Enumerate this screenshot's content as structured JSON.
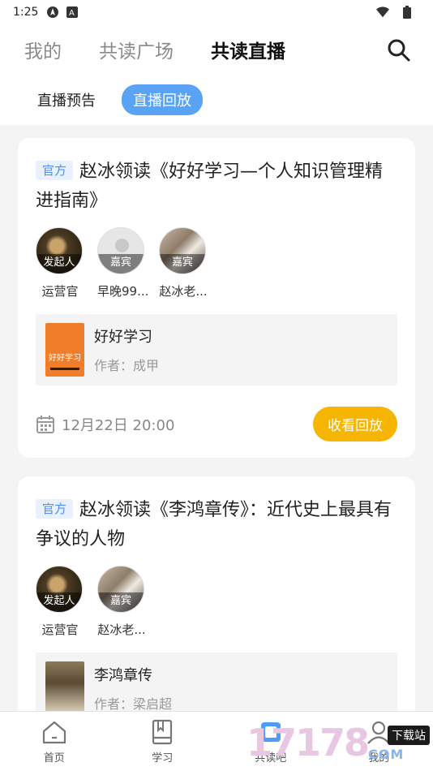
{
  "status_bar": {
    "time": "1:25",
    "icons": [
      "navigation-icon",
      "text-a-icon",
      "wifi-icon",
      "battery-icon"
    ]
  },
  "top_tabs": {
    "items": [
      {
        "label": "我的",
        "active": false
      },
      {
        "label": "共读广场",
        "active": false
      },
      {
        "label": "共读直播",
        "active": true
      }
    ],
    "search_icon": "search-icon"
  },
  "sub_tabs": {
    "items": [
      {
        "label": "直播预告",
        "active": false
      },
      {
        "label": "直播回放",
        "active": true
      }
    ]
  },
  "cards": [
    {
      "tag": "官方",
      "title": "赵冰领读《好好学习—个人知识管理精进指南》",
      "members": [
        {
          "role": "发起人",
          "name": "运营官"
        },
        {
          "role": "嘉宾",
          "name": "早晚99..."
        },
        {
          "role": "嘉宾",
          "name": "赵冰老..."
        }
      ],
      "book": {
        "title": "好好学习",
        "author": "作者：成甲",
        "cover_text": "好好学习"
      },
      "date": "12月22日 20:00",
      "button": "收看回放"
    },
    {
      "tag": "官方",
      "title": "赵冰领读《李鸿章传》：近代史上最具有争议的人物",
      "members": [
        {
          "role": "发起人",
          "name": "运营官"
        },
        {
          "role": "嘉宾",
          "name": "赵冰老..."
        }
      ],
      "book": {
        "title": "李鸿章传",
        "author": "作者：梁启超"
      }
    }
  ],
  "bottom_nav": [
    {
      "label": "首页",
      "icon": "home-icon"
    },
    {
      "label": "学习",
      "icon": "book-icon"
    },
    {
      "label": "共读吧",
      "icon": "group-read-icon"
    },
    {
      "label": "我的",
      "icon": "profile-icon"
    }
  ],
  "watermark": {
    "number": "17178",
    "domain": "COM",
    "label": "下载站"
  },
  "colors": {
    "accent_blue": "#5aa3f4",
    "button_yellow": "#f6b500",
    "tag_blue": "#4d8ff0"
  }
}
